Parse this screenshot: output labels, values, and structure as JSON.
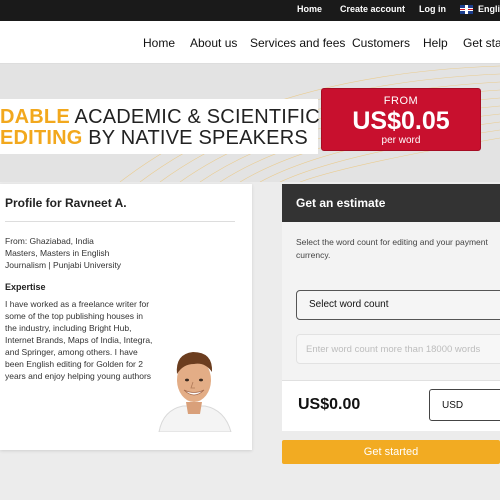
{
  "topbar": {
    "home": "Home",
    "create_account": "Create account",
    "login": "Log in",
    "language": "English"
  },
  "nav": {
    "items": [
      "Home",
      "About us",
      "Services and fees",
      "Customers",
      "Help",
      "Get started"
    ]
  },
  "hero": {
    "line1_highlight": "DABLE",
    "line1_rest": " ACADEMIC & SCIENTIFIC",
    "line2_highlight": " EDITING",
    "line2_rest": " BY NATIVE SPEAKERS",
    "price_from": "FROM",
    "price_amount": "US$0.05",
    "price_unit": "per word"
  },
  "profile": {
    "title": "Profile for Ravneet A.",
    "from": "From: Ghaziabad, India",
    "degrees": "Masters, Masters in English",
    "university": "Journalism | Punjabi University",
    "expertise_heading": "Expertise",
    "expertise_text": "I have worked as a freelance writer for some of the top publishing houses in the industry, including Bright Hub, Internet Brands, Maps of India, Integra, and Springer, among others. I have been English editing for Golden for 2 years and enjoy helping young authors"
  },
  "estimate": {
    "heading": "Get an estimate",
    "description": "Select the word count for editing and your payment currency.",
    "select_label": "Select word count",
    "input_placeholder": "Enter word count more than 18000 words",
    "total": "US$0.00",
    "currency": "USD",
    "cta": "Get started"
  },
  "colors": {
    "accent_gold": "#f2a81d",
    "price_red": "#c8102e",
    "dark_header": "#333333"
  }
}
